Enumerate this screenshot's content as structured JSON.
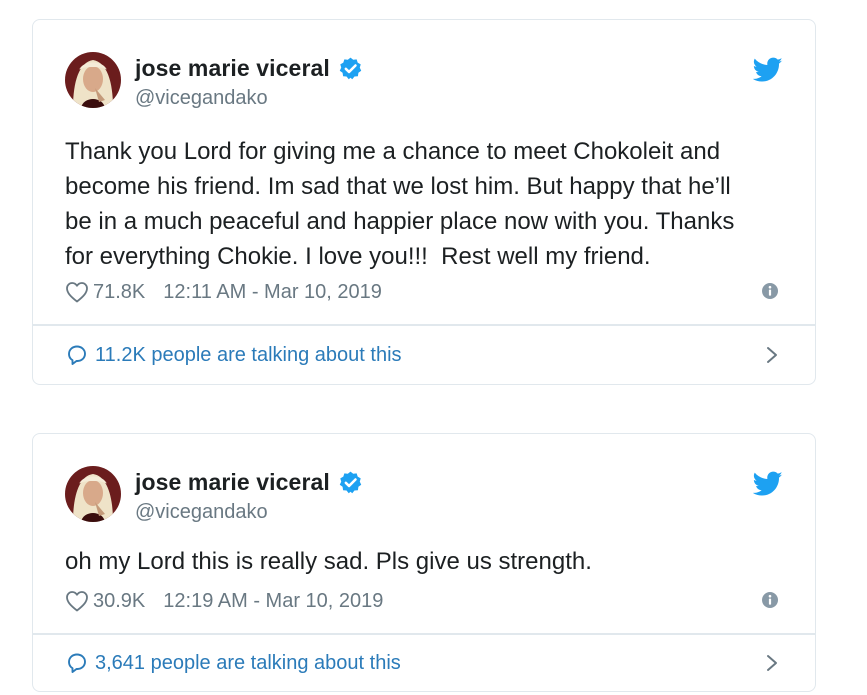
{
  "colors": {
    "text": "#1c2022",
    "secondary": "#697882",
    "link": "#2b7bb9",
    "twitter_blue": "#1da1f2",
    "border": "#e1e8ed"
  },
  "tweets": [
    {
      "author": {
        "display_name": "jose marie viceral",
        "handle": "@vicegandako",
        "verified": true
      },
      "text": "Thank you Lord for giving me a chance to meet Chokoleit and\nbecome his friend. Im sad that we lost him. But happy that he’ll\nbe in a much peaceful and happier place now with you. Thanks\nfor everything Chokie. I love you!!!  Rest well my friend.",
      "likes": "71.8K",
      "timestamp": "12:11 AM - Mar 10, 2019",
      "talking": "11.2K people are talking about this",
      "icons": [
        "heart-icon",
        "info-icon",
        "reply-bubble-icon",
        "chevron-right-icon",
        "twitter-bird-icon",
        "verified-badge-icon"
      ]
    },
    {
      "author": {
        "display_name": "jose marie viceral",
        "handle": "@vicegandako",
        "verified": true
      },
      "text": "oh my Lord this is really sad. Pls give us strength.",
      "likes": "30.9K",
      "timestamp": "12:19 AM - Mar 10, 2019",
      "talking": "3,641 people are talking about this",
      "icons": [
        "heart-icon",
        "info-icon",
        "reply-bubble-icon",
        "chevron-right-icon",
        "twitter-bird-icon",
        "verified-badge-icon"
      ]
    }
  ]
}
